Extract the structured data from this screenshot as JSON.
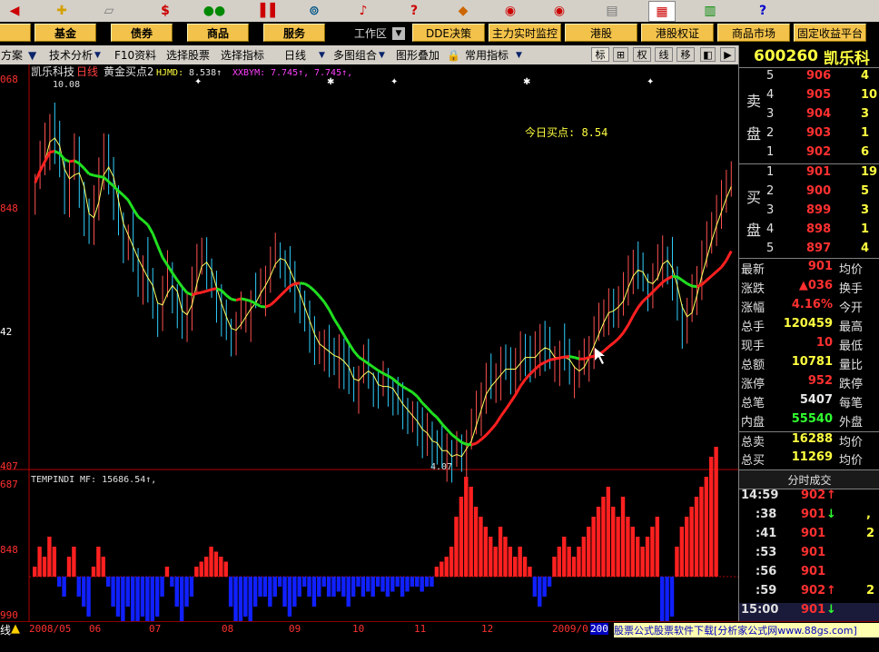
{
  "toolbar": {
    "icons": [
      "left-arrow-icon",
      "add-icon",
      "ruler-icon",
      "dollar-icon",
      "traffic-light-icon",
      "bars-icon",
      "binoculars-icon",
      "bell-icon",
      "question-icon",
      "diamond-icon",
      "dollar-circle-icon",
      "pen-circle-icon",
      "print-icon",
      "calendar-icon",
      "books-icon",
      "help-icon"
    ],
    "dollar": "$"
  },
  "menubar": {
    "left": [
      "基金",
      "债券",
      "商品",
      "服务"
    ],
    "workspace": "工作区",
    "right": [
      "DDE决策",
      "主力实时监控",
      "港股",
      "港股权证",
      "商品市场",
      "固定收益平台"
    ]
  },
  "subbar": {
    "items": [
      "方案",
      "技术分析",
      "F10资料",
      "选择股票",
      "选择指标",
      "日线",
      "多图组合",
      "图形叠加",
      "常用指标"
    ],
    "icons": [
      "标",
      "田",
      "权",
      "线",
      "移"
    ]
  },
  "chart": {
    "stock_name": "凯乐科技",
    "period": "日线",
    "indicator_name": "黄金买点2",
    "ind1_label": "HJMD:",
    "ind1_value": "8.538↑",
    "ind2_label": "XXBYM:",
    "ind2_value": "7.745↑,",
    "ind2_value2": "7.745↑,",
    "high_label": "10.08",
    "low_label": "4.07",
    "buy_point": "今日买点: 8.54",
    "price_axis": [
      "068",
      "848",
      "42",
      "407"
    ],
    "lower_title": "TEMPINDI",
    "lower_mf": "MF: 15686.54↑,",
    "vol_axis": [
      "687",
      "848",
      "990"
    ],
    "date_axis": [
      "2008/05",
      "06",
      "07",
      "08",
      "09",
      "10",
      "11",
      "12",
      "2009/0",
      "200"
    ]
  },
  "chart_data": {
    "type": "candlestick",
    "ylim": [
      4.07,
      10.68
    ],
    "closes": [
      8.9,
      9.3,
      9.6,
      9.9,
      9.5,
      9.2,
      8.7,
      9.0,
      9.4,
      8.8,
      8.3,
      8.0,
      8.6,
      9.1,
      9.4,
      9.0,
      8.6,
      8.2,
      7.8,
      8.0,
      7.6,
      7.2,
      7.5,
      7.1,
      6.8,
      6.6,
      7.0,
      7.4,
      7.0,
      6.7,
      6.4,
      6.8,
      7.2,
      7.5,
      7.7,
      7.4,
      7.1,
      6.8,
      6.6,
      6.4,
      6.2,
      6.5,
      6.7,
      6.6,
      6.9,
      7.0,
      7.1,
      7.3,
      7.5,
      7.7,
      7.6,
      7.4,
      7.2,
      7.0,
      6.8,
      6.5,
      6.3,
      6.1,
      6.0,
      6.1,
      5.9,
      5.8,
      6.0,
      5.7,
      5.5,
      5.4,
      5.6,
      5.8,
      5.6,
      5.4,
      5.3,
      5.5,
      5.4,
      5.2,
      5.1,
      5.0,
      4.9,
      4.8,
      4.7,
      4.5,
      4.6,
      4.3,
      4.4,
      4.2,
      4.3,
      4.1,
      4.3,
      4.2,
      4.5,
      4.7,
      5.0,
      5.3,
      5.5,
      5.4,
      5.6,
      5.8,
      5.7,
      5.6,
      5.8,
      6.0,
      5.9,
      5.8,
      6.0,
      6.2,
      6.0,
      5.9,
      5.8,
      6.0,
      5.9,
      5.7,
      5.6,
      5.7,
      5.9,
      6.1,
      6.3,
      6.5,
      6.7,
      6.8,
      6.6,
      6.9,
      7.1,
      7.3,
      7.5,
      7.4,
      7.2,
      7.0,
      7.3,
      7.5,
      7.7,
      7.5,
      7.1,
      6.8,
      6.4,
      6.6,
      7.0,
      7.3,
      7.6,
      7.9,
      8.2,
      8.4,
      8.6,
      8.9,
      9.0
    ],
    "vol": [
      0.1,
      0.3,
      0.2,
      0.4,
      0.3,
      -0.1,
      -0.2,
      0.2,
      0.3,
      -0.2,
      -0.3,
      -0.4,
      0.1,
      0.3,
      0.2,
      -0.1,
      -0.3,
      -0.4,
      -0.5,
      -0.3,
      -0.6,
      -0.7,
      -0.4,
      -0.5,
      -0.6,
      -0.4,
      -0.2,
      0.1,
      -0.1,
      -0.3,
      -0.5,
      -0.3,
      -0.2,
      0.1,
      0.15,
      0.2,
      0.3,
      0.25,
      0.2,
      0.15,
      -0.3,
      -0.5,
      -0.6,
      -0.4,
      -0.5,
      -0.3,
      -0.2,
      -0.2,
      -0.3,
      -0.2,
      -0.1,
      -0.3,
      -0.4,
      -0.3,
      -0.2,
      -0.1,
      -0.2,
      -0.3,
      -0.2,
      -0.1,
      -0.2,
      -0.2,
      -0.15,
      -0.2,
      -0.3,
      -0.2,
      -0.1,
      -0.2,
      -0.15,
      -0.2,
      -0.1,
      -0.15,
      -0.2,
      -0.15,
      -0.1,
      -0.2,
      -0.15,
      -0.1,
      -0.1,
      -0.15,
      -0.1,
      -0.1,
      0.1,
      0.15,
      0.2,
      0.3,
      0.6,
      0.8,
      1.0,
      0.9,
      0.7,
      0.6,
      0.5,
      0.4,
      0.3,
      0.5,
      0.4,
      0.3,
      0.2,
      0.3,
      0.2,
      0.1,
      -0.2,
      -0.3,
      -0.2,
      -0.1,
      0.2,
      0.3,
      0.4,
      0.3,
      0.2,
      0.3,
      0.4,
      0.5,
      0.6,
      0.7,
      0.8,
      0.9,
      0.7,
      0.6,
      0.8,
      0.6,
      0.5,
      0.4,
      0.3,
      0.4,
      0.5,
      0.6,
      -0.5,
      -0.8,
      -0.4,
      0.3,
      0.5,
      0.6,
      0.7,
      0.8,
      0.9,
      1.0,
      1.2,
      1.3
    ]
  },
  "panel": {
    "code": "600260",
    "name": "凯乐科",
    "sell_label": [
      "卖",
      "盘"
    ],
    "buy_label": [
      "买",
      "盘"
    ],
    "asks": [
      [
        "5",
        "906",
        "4"
      ],
      [
        "4",
        "905",
        "10"
      ],
      [
        "3",
        "904",
        "3"
      ],
      [
        "2",
        "903",
        "1"
      ],
      [
        "1",
        "902",
        "6"
      ]
    ],
    "bids": [
      [
        "1",
        "901",
        "19"
      ],
      [
        "2",
        "900",
        "5"
      ],
      [
        "3",
        "899",
        "3"
      ],
      [
        "4",
        "898",
        "1"
      ],
      [
        "5",
        "897",
        "4"
      ]
    ],
    "stats": [
      [
        "最新",
        "901",
        "均价"
      ],
      [
        "涨跌",
        "▲036",
        "换手"
      ],
      [
        "涨幅",
        "4.16%",
        "今开"
      ],
      [
        "总手",
        "120459",
        "最高"
      ],
      [
        "现手",
        "10",
        "最低"
      ],
      [
        "总额",
        "10781",
        "量比"
      ],
      [
        "涨停",
        "952",
        "跌停"
      ],
      [
        "总笔",
        "5407",
        "每笔"
      ],
      [
        "内盘",
        "55540",
        "外盘"
      ],
      [
        "总卖",
        "16288",
        "均价"
      ],
      [
        "总买",
        "11269",
        "均价"
      ]
    ],
    "ticks_title": "分时成交",
    "ticks": [
      [
        "14:59",
        "902",
        "↑"
      ],
      [
        ":38",
        "901",
        "↓"
      ],
      [
        ":41",
        "901",
        ""
      ],
      [
        ":53",
        "901",
        ""
      ],
      [
        ":56",
        "901",
        ""
      ],
      [
        ":59",
        "902",
        "↑"
      ],
      [
        "15:00",
        "901",
        "↓"
      ]
    ],
    "tick_vol": [
      "",
      ",",
      "2",
      "",
      "",
      "2",
      ""
    ]
  },
  "status": {
    "ad": "股票公式股票软件下载[分析家公式网www.88gs.com]",
    "left": "线"
  }
}
